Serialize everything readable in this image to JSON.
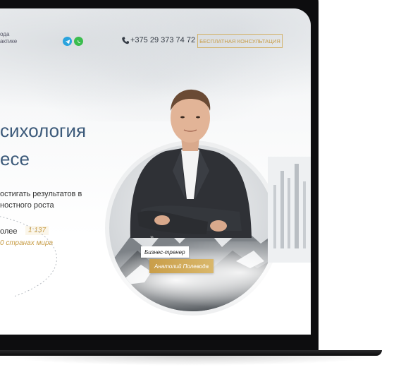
{
  "header": {
    "brand_line1": "ода",
    "brand_line2": "актике",
    "phone": "+375 29 373 74 72",
    "consult_button": "БЕСПЛАТНАЯ КОНСУЛЬТАЦИЯ",
    "icons": [
      "telegram-icon",
      "whatsapp-icon",
      "phone-icon"
    ]
  },
  "hero": {
    "title_line1": "сихология",
    "title_line2": "есе",
    "subtitle_line1": "остигать результатов в",
    "subtitle_line2": "ностного роста",
    "stat_prefix": "олее",
    "stat_number": "1 137",
    "stat_countries": "0 странах мира"
  },
  "portrait": {
    "role": "Бизнес-тренер",
    "name": "Анатолий Полевода",
    "arrow": "›››"
  },
  "colors": {
    "accent": "#c79c45",
    "heading": "#3c5a7a",
    "telegram": "#2aa3dd",
    "whatsapp": "#3bbd4e"
  }
}
